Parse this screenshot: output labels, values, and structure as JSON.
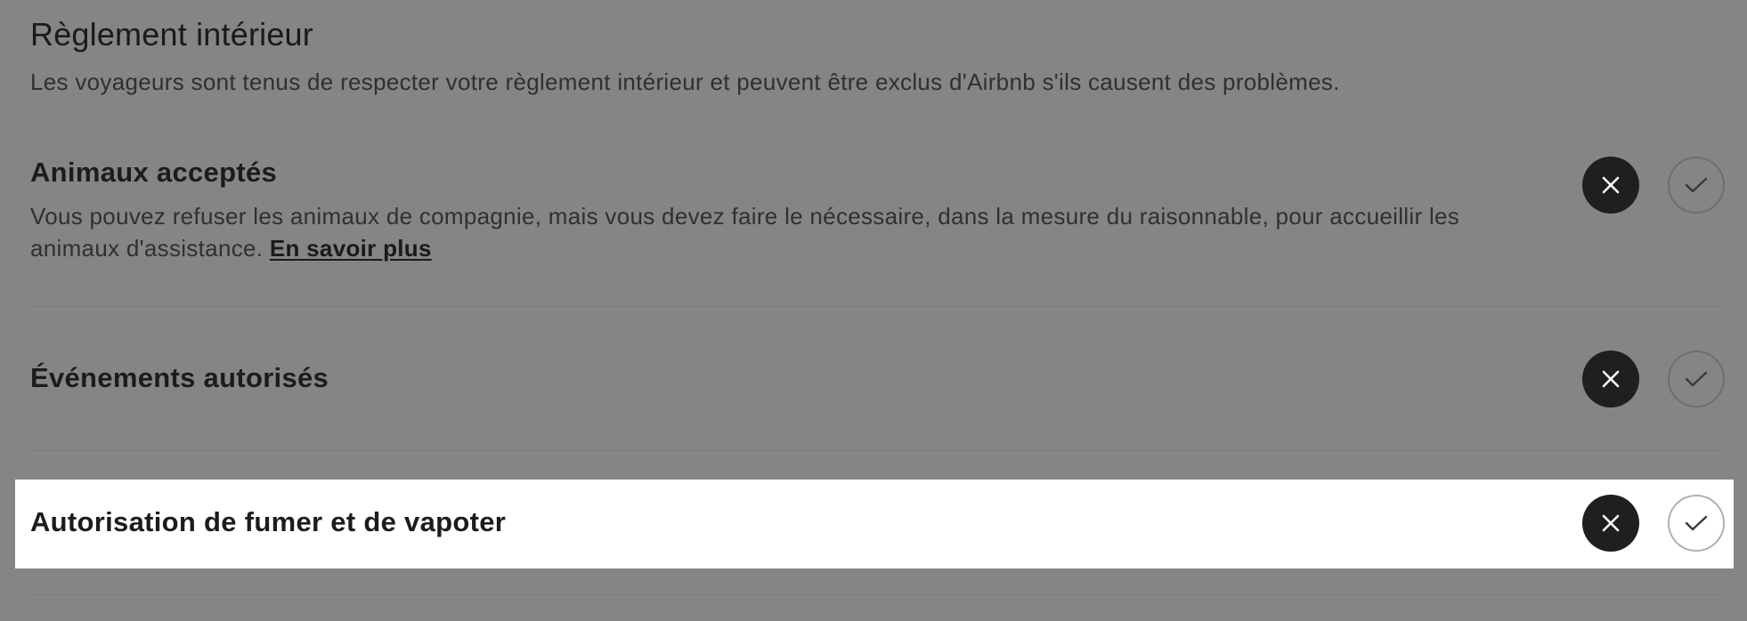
{
  "section": {
    "title": "Règlement intérieur",
    "subtitle": "Les voyageurs sont tenus de respecter votre règlement intérieur et peuvent être exclus d'Airbnb s'ils causent des problèmes."
  },
  "rules": [
    {
      "title": "Animaux acceptés",
      "description": "Vous pouvez refuser les animaux de compagnie, mais vous devez faire le nécessaire, dans la mesure du raisonnable, pour accueillir les animaux d'assistance.",
      "link_label": "En savoir plus",
      "deny_icon": "close-icon",
      "allow_icon": "check-icon"
    },
    {
      "title": "Événements autorisés",
      "deny_icon": "close-icon",
      "allow_icon": "check-icon"
    },
    {
      "title": "Autorisation de fumer et de vapoter",
      "highlighted": true,
      "deny_icon": "close-icon",
      "allow_icon": "check-icon"
    }
  ],
  "colors": {
    "overlay": "#858585",
    "highlight": "#ffffff",
    "deny_button": "#1f1f1f",
    "text": "#222222"
  }
}
